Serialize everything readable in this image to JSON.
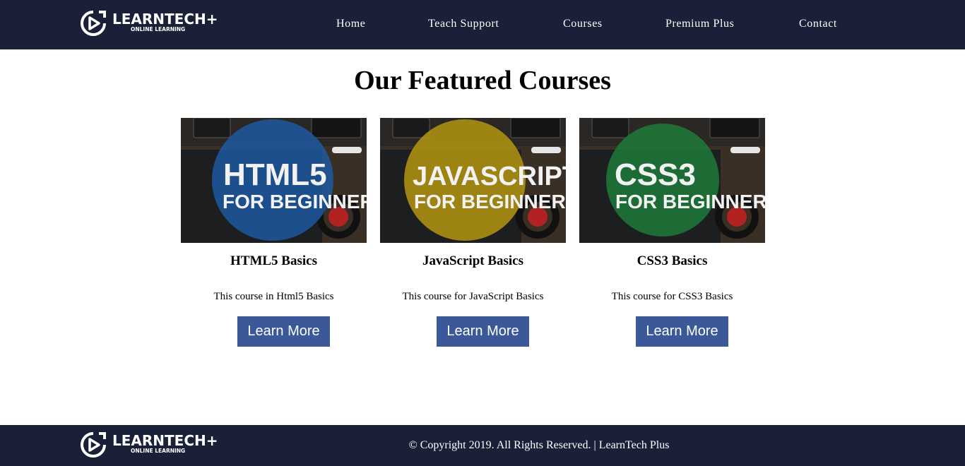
{
  "brand": {
    "name": "LEARNTECH+",
    "tagline": "ONLINE LEARNING"
  },
  "nav": {
    "items": [
      "Home",
      "Teach Support",
      "Courses",
      "Premium Plus",
      "Contact"
    ]
  },
  "main": {
    "title": "Our Featured Courses",
    "courses": [
      {
        "thumb_line1": "HTML5",
        "thumb_line2": "FOR BEGINNERS",
        "thumb_color": "#1f5aa6",
        "title": "HTML5 Basics",
        "description": "This course in Html5 Basics",
        "button": "Learn More"
      },
      {
        "thumb_line1": "JAVASCRIPT",
        "thumb_line2": "FOR BEGINNERS",
        "thumb_color": "#b89a10",
        "title": "JavaScript Basics",
        "description": "This course for JavaScript Basics",
        "button": "Learn More"
      },
      {
        "thumb_line1": "CSS3",
        "thumb_line2": "FOR BEGINNERS",
        "thumb_color": "#1f7a3a",
        "title": "CSS3 Basics",
        "description": "This course for CSS3 Basics",
        "button": "Learn More"
      }
    ]
  },
  "footer": {
    "copyright": "© Copyright 2019. All Rights Reserved. | LearnTech Plus"
  },
  "colors": {
    "header_bg": "#1a2038",
    "button_bg": "#3b5998"
  }
}
